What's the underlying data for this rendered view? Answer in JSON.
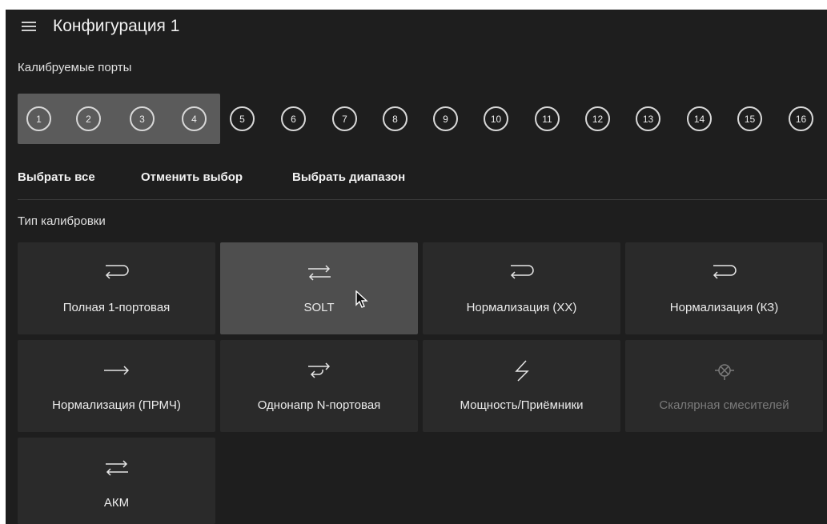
{
  "header": {
    "title": "Конфигурация 1"
  },
  "ports": {
    "label": "Калибруемые порты",
    "items": [
      "1",
      "2",
      "3",
      "4",
      "5",
      "6",
      "7",
      "8",
      "9",
      "10",
      "11",
      "12",
      "13",
      "14",
      "15",
      "16"
    ],
    "selected": [
      "1",
      "2",
      "3",
      "4"
    ]
  },
  "actions": {
    "select_all": "Выбрать все",
    "deselect": "Отменить выбор",
    "select_range": "Выбрать диапазон"
  },
  "calibration": {
    "label": "Тип калибровки",
    "tiles": [
      {
        "label": "Полная 1-портовая",
        "icon": "u-turn-icon",
        "state": "normal"
      },
      {
        "label": "SOLT",
        "icon": "bidirectional-arrows-icon",
        "state": "selected"
      },
      {
        "label": "Нормализация (XX)",
        "icon": "u-turn-icon",
        "state": "normal"
      },
      {
        "label": "Нормализация (КЗ)",
        "icon": "u-turn-icon",
        "state": "normal"
      },
      {
        "label": "Нормализация (ПРМЧ)",
        "icon": "right-arrow-icon",
        "state": "normal"
      },
      {
        "label": "Однонапр N-портовая",
        "icon": "one-path-arrow-icon",
        "state": "normal"
      },
      {
        "label": "Мощность/Приёмники",
        "icon": "lightning-icon",
        "state": "normal"
      },
      {
        "label": "Скалярная смесителей",
        "icon": "mixer-icon",
        "state": "disabled"
      },
      {
        "label": "АКМ",
        "icon": "bidirectional-arrows-icon",
        "state": "normal"
      }
    ]
  },
  "colors": {
    "background": "#1e1e1e",
    "tile": "#2a2a2a",
    "tile_selected": "#4e4e4e",
    "port_group": "#5b5b5b"
  }
}
